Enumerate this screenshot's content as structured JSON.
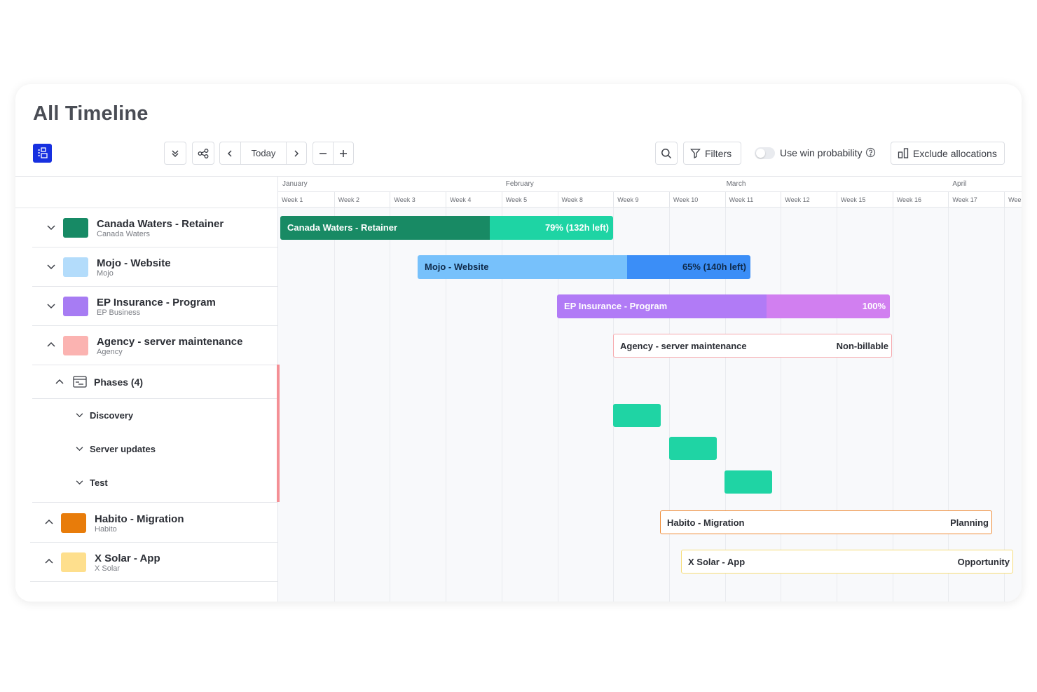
{
  "page": {
    "title": "All Timeline"
  },
  "toolbar": {
    "today_label": "Today",
    "filters_label": "Filters",
    "win_probability_label": "Use win probability",
    "exclude_allocations_label": "Exclude allocations"
  },
  "timeline": {
    "months": [
      {
        "label": "January",
        "week_index": 0
      },
      {
        "label": "February",
        "week_index": 4
      },
      {
        "label": "March",
        "week_index": 8
      },
      {
        "label": "April",
        "week_index": 12
      }
    ],
    "weeks": [
      "Week 1",
      "Week 2",
      "Week 3",
      "Week 4",
      "Week 5",
      "Week 8",
      "Week 9",
      "Week 10",
      "Week 11",
      "Week 12",
      "Week 15",
      "Week 16",
      "Week 17",
      "Week"
    ]
  },
  "projects": [
    {
      "name": "Canada Waters - Retainer",
      "client": "Canada Waters",
      "color": "#178a65",
      "expanded": false
    },
    {
      "name": "Mojo - Website",
      "client": "Mojo",
      "color": "#b3dcfb",
      "expanded": false
    },
    {
      "name": "EP Insurance - Program",
      "client": "EP Business",
      "color": "#a77cf3",
      "expanded": false
    },
    {
      "name": "Agency - server maintenance",
      "client": "Agency",
      "color": "#fbb3b1",
      "expanded": true
    },
    {
      "name": "Habito - Migration",
      "client": "Habito",
      "color": "#e87c0a",
      "expanded": true
    },
    {
      "name": "X Solar - App",
      "client": "X Solar",
      "color": "#fedf8d",
      "expanded": true
    }
  ],
  "phases": {
    "label": "Phases (4)",
    "items": [
      "Discovery",
      "Server updates",
      "Test"
    ]
  },
  "bars": {
    "canada": {
      "label": "Canada Waters - Retainer",
      "status": "79% (132h left)",
      "progress": 0.63,
      "color_done": "#188a64",
      "color_rest": "#1ed4a4"
    },
    "mojo": {
      "label": "Mojo - Website",
      "status": "65% (140h left)",
      "progress": 0.63,
      "color_done": "#77c1fb",
      "color_rest": "#3b8ef7"
    },
    "ep": {
      "label": "EP Insurance - Program",
      "status": "100%",
      "progress": 0.63,
      "color_done": "#b17bf6",
      "color_rest": "#d17ff0"
    },
    "agency": {
      "label": "Agency - server maintenance",
      "status": "Non-billable",
      "border": "#f6a9ad"
    },
    "habito": {
      "label": "Habito - Migration",
      "status": "Planning",
      "border": "#ee8b36"
    },
    "xsolar": {
      "label": "X Solar - App",
      "status": "Opportunity",
      "border": "#f6dc78"
    }
  }
}
